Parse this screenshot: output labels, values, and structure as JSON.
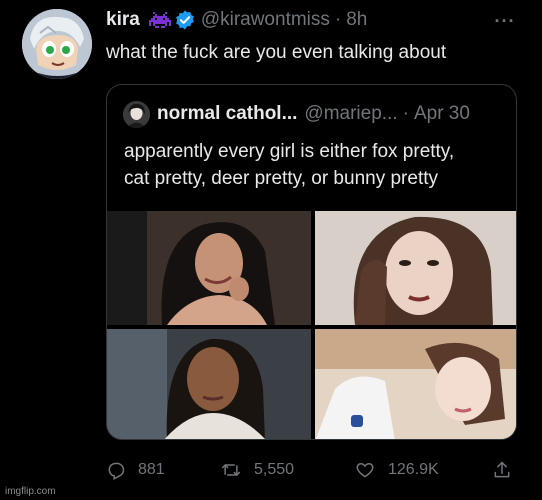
{
  "author": {
    "name": "kira",
    "handle": "@kirawontmiss",
    "separator": "·",
    "time": "8h",
    "badge_emoji": "space-invader-emoji",
    "verified_icon": "verified-badge-icon"
  },
  "tweet": {
    "text": "what the fuck are you even talking about"
  },
  "more_icon": "ellipsis-icon",
  "quoted": {
    "name": "normal cathol...",
    "handle": "@mariep...",
    "separator": "·",
    "time": "Apr 30",
    "text_lines": [
      "apparently every girl is either fox pretty,",
      "cat pretty, deer pretty, or bunny pretty"
    ],
    "photos": [
      "photo-1",
      "photo-2",
      "photo-3",
      "photo-4"
    ]
  },
  "actions": {
    "replies": "881",
    "retweets": "5,550",
    "likes": "126.9K",
    "reply_icon": "reply-icon",
    "retweet_icon": "retweet-icon",
    "like_icon": "heart-icon",
    "share_icon": "share-icon"
  },
  "watermark": "imgflip.com",
  "colors": {
    "background": "#000000",
    "text": "#e7e9ea",
    "muted": "#71767b",
    "verified": "#1d9bf0",
    "border": "#333639",
    "emoji_purple": "#7b2fd6"
  }
}
